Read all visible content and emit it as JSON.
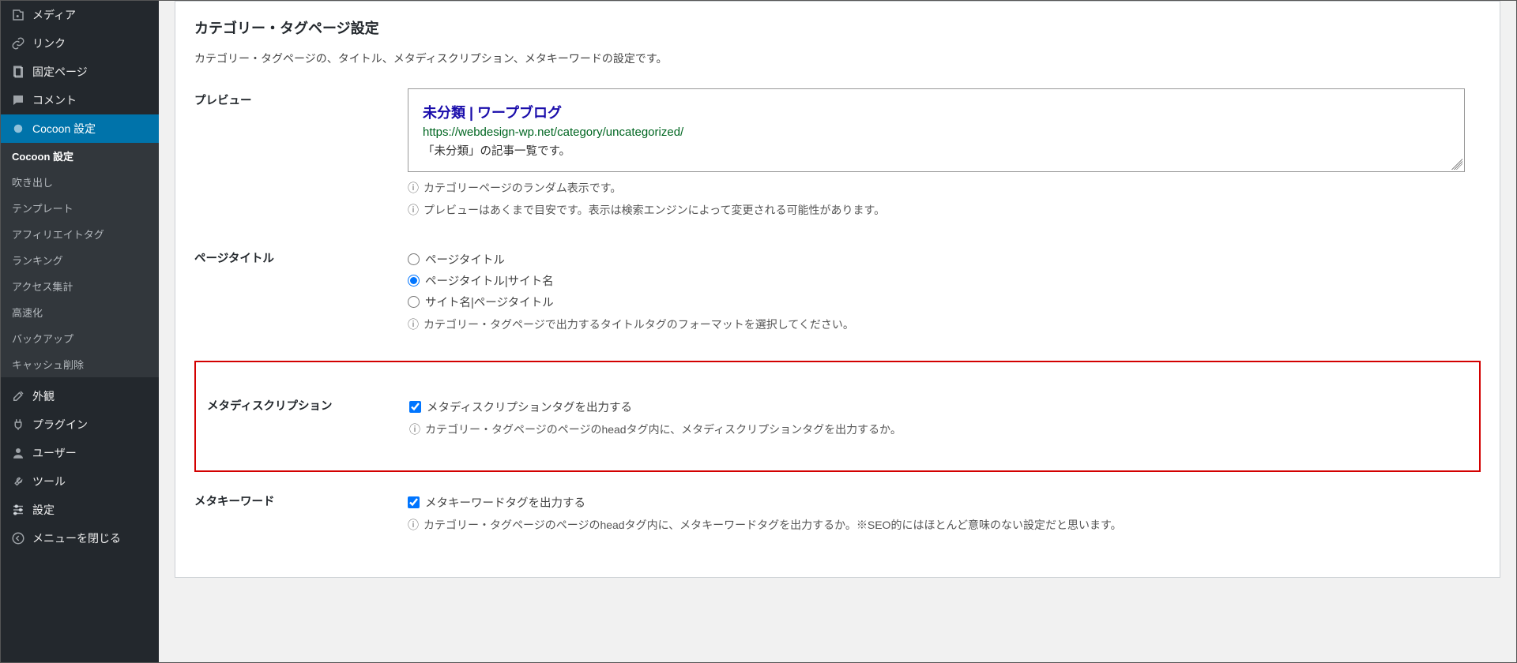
{
  "sidebar": {
    "items": [
      {
        "label": "メディア",
        "icon": "media-icon"
      },
      {
        "label": "リンク",
        "icon": "link-icon"
      },
      {
        "label": "固定ページ",
        "icon": "page-icon"
      },
      {
        "label": "コメント",
        "icon": "comment-icon"
      },
      {
        "label": "Cocoon 設定",
        "icon": "dot-icon",
        "active": true
      }
    ],
    "sub": [
      "Cocoon 設定",
      "吹き出し",
      "テンプレート",
      "アフィリエイトタグ",
      "ランキング",
      "アクセス集計",
      "高速化",
      "バックアップ",
      "キャッシュ削除"
    ],
    "lower": [
      {
        "label": "外観",
        "icon": "brush-icon"
      },
      {
        "label": "プラグイン",
        "icon": "plugin-icon"
      },
      {
        "label": "ユーザー",
        "icon": "user-icon"
      },
      {
        "label": "ツール",
        "icon": "wrench-icon"
      },
      {
        "label": "設定",
        "icon": "sliders-icon"
      },
      {
        "label": "メニューを閉じる",
        "icon": "collapse-icon"
      }
    ]
  },
  "panel": {
    "section_title": "カテゴリー・タグページ設定",
    "section_desc": "カテゴリー・タグページの、タイトル、メタディスクリプション、メタキーワードの設定です。",
    "preview": {
      "label": "プレビュー",
      "title": "未分類 | ワープブログ",
      "url": "https://webdesign-wp.net/category/uncategorized/",
      "snippet": "「未分類」の記事一覧です。",
      "info1": "カテゴリーページのランダム表示です。",
      "info2": "プレビューはあくまで目安です。表示は検索エンジンによって変更される可能性があります。"
    },
    "page_title": {
      "label": "ページタイトル",
      "opt1": "ページタイトル",
      "opt2": "ページタイトル|サイト名",
      "opt3": "サイト名|ページタイトル",
      "info": "カテゴリー・タグページで出力するタイトルタグのフォーマットを選択してください。"
    },
    "meta_desc": {
      "label": "メタディスクリプション",
      "checkbox": "メタディスクリプションタグを出力する",
      "info": "カテゴリー・タグページのページのheadタグ内に、メタディスクリプションタグを出力するか。"
    },
    "meta_key": {
      "label": "メタキーワード",
      "checkbox": "メタキーワードタグを出力する",
      "info": "カテゴリー・タグページのページのheadタグ内に、メタキーワードタグを出力するか。※SEO的にはほとんど意味のない設定だと思います。"
    }
  }
}
